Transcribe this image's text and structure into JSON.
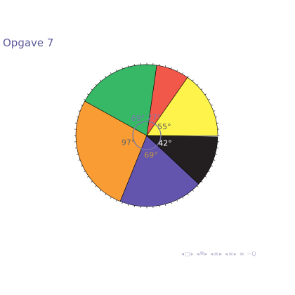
{
  "slide": {
    "title": "Opgave 7"
  },
  "chart_data": {
    "type": "pie",
    "title": "",
    "unit": "degrees",
    "slices": [
      {
        "label": "55°",
        "value": 55,
        "color": "#fdf34b",
        "label_color": "#555555"
      },
      {
        "label": "27°",
        "value": 27,
        "color": "#f2584a",
        "label_color": "#7a7ab0"
      },
      {
        "label": "69°",
        "value": 69,
        "color": "#36b866",
        "label_color": "#7a7ab0"
      },
      {
        "label": "97°",
        "value": 97,
        "color": "#f89c33",
        "label_color": "#666666"
      },
      {
        "label": "69°",
        "value": 69,
        "color": "#6354ad",
        "label_color": "#c49a3a"
      },
      {
        "label": "42°",
        "value": 42,
        "color": "#231f20",
        "label_color": "#ffffff"
      }
    ],
    "start_angle_deg": 0,
    "direction": "counterclockwise",
    "legend": "none",
    "grid": false
  },
  "nav": {
    "icons": [
      "nav-first-icon",
      "nav-prev-icon",
      "nav-section-icon",
      "nav-subsection-icon",
      "nav-frame-icon",
      "nav-next-icon",
      "nav-last-icon",
      "nav-search-icon"
    ]
  }
}
